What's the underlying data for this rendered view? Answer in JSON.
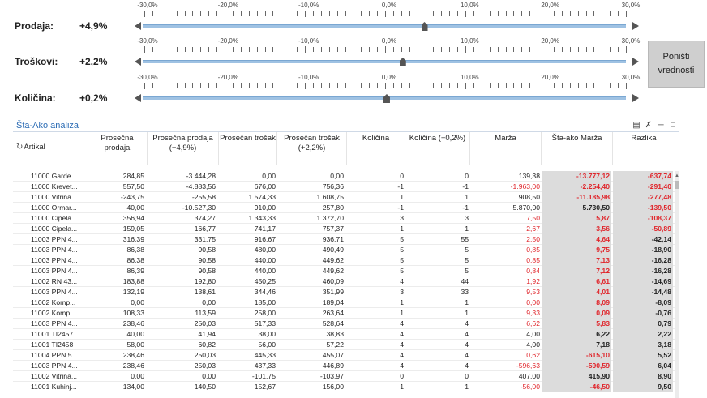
{
  "sliders": [
    {
      "label": "Prodaja:",
      "value": "+4,9%",
      "level_percent": 4.9
    },
    {
      "label": "Troškovi:",
      "value": "+2,2%",
      "level_percent": 2.2
    },
    {
      "label": "Količina:",
      "value": "+0,2%",
      "level_percent": 0.2
    }
  ],
  "tick_labels": [
    "-30,0%",
    "-20,0%",
    "-10,0%",
    "0,0%",
    "10,0%",
    "20,0%",
    "30,0%"
  ],
  "reset_button": {
    "label": "Poništi vrednosti"
  },
  "panel": {
    "title": "Šta-Ako analiza"
  },
  "columns": {
    "artikal": "Artikal",
    "c1": "Prosečna prodaja",
    "c2": "Prosečna prodaja (+4,9%)",
    "c3": "Prosečan trošak",
    "c4": "Prosečan trošak (+2,2%)",
    "c5": "Količina",
    "c6": "Količina (+0,2%)",
    "c7": "Marža",
    "c8": "Šta-ako Marža",
    "c9": "Razlika"
  },
  "rows": [
    [
      "11000 Garde...",
      "284,85",
      "-3.444,28",
      "0,00",
      "0,00",
      "0",
      "0",
      "139,38",
      "-13.777,12",
      "-637,74"
    ],
    [
      "11000 Krevet...",
      "557,50",
      "-4.883,56",
      "676,00",
      "756,36",
      "-1",
      "-1",
      "-1.963,00",
      "-2.254,40",
      "-291,40"
    ],
    [
      "11000 Vitrina...",
      "-243,75",
      "-255,58",
      "1.574,33",
      "1.608,75",
      "1",
      "1",
      "908,50",
      "-11.185,98",
      "-277,48"
    ],
    [
      "11000 Ormar...",
      "40,00",
      "-10.527,30",
      "910,00",
      "257,80",
      "-1",
      "-1",
      "5.870,00",
      "5.730,50",
      "-139,50"
    ],
    [
      "11000 Cipela...",
      "356,94",
      "374,27",
      "1.343,33",
      "1.372,70",
      "3",
      "3",
      "7,50",
      "5,87",
      "-108,37"
    ],
    [
      "11000 Cipela...",
      "159,05",
      "166,77",
      "741,17",
      "757,37",
      "1",
      "1",
      "2,67",
      "3,56",
      "-50,89"
    ],
    [
      "11003 PPN 4...",
      "316,39",
      "331,75",
      "916,67",
      "936,71",
      "5",
      "55",
      "2,50",
      "4,64",
      "-42,14"
    ],
    [
      "11003 PPN 4...",
      "86,38",
      "90,58",
      "480,00",
      "490,49",
      "5",
      "5",
      "0,85",
      "9,75",
      "-18,90"
    ],
    [
      "11003 PPN 4...",
      "86,38",
      "90,58",
      "440,00",
      "449,62",
      "5",
      "5",
      "0,85",
      "7,13",
      "-16,28"
    ],
    [
      "11003 PPN 4...",
      "86,39",
      "90,58",
      "440,00",
      "449,62",
      "5",
      "5",
      "0,84",
      "7,12",
      "-16,28"
    ],
    [
      "11002 RN 43...",
      "183,88",
      "192,80",
      "450,25",
      "460,09",
      "4",
      "44",
      "1,92",
      "6,61",
      "-14,69"
    ],
    [
      "11003 PPN 4...",
      "132,19",
      "138,61",
      "344,46",
      "351,99",
      "3",
      "33",
      "9,53",
      "4,01",
      "-14,48"
    ],
    [
      "11002 Komp...",
      "0,00",
      "0,00",
      "185,00",
      "189,04",
      "1",
      "1",
      "0,00",
      "8,09",
      "-8,09"
    ],
    [
      "11002 Komp...",
      "108,33",
      "113,59",
      "258,00",
      "263,64",
      "1",
      "1",
      "9,33",
      "0,09",
      "-0,76"
    ],
    [
      "11003 PPN 4...",
      "238,46",
      "250,03",
      "517,33",
      "528,64",
      "4",
      "4",
      "6,62",
      "5,83",
      "0,79"
    ],
    [
      "11001 TI2457",
      "40,00",
      "41,94",
      "38,00",
      "38,83",
      "4",
      "4",
      "4,00",
      "6,22",
      "2,22"
    ],
    [
      "11001 TI2458",
      "58,00",
      "60,82",
      "56,00",
      "57,22",
      "4",
      "4",
      "4,00",
      "7,18",
      "3,18"
    ],
    [
      "11004 PPN 5...",
      "238,46",
      "250,03",
      "445,33",
      "455,07",
      "4",
      "4",
      "0,62",
      "-615,10",
      "5,52"
    ],
    [
      "11003 PPN 4...",
      "238,46",
      "250,03",
      "437,33",
      "446,89",
      "4",
      "4",
      "-596,63",
      "-590,59",
      "6,04"
    ],
    [
      "11002 Vitrina...",
      "0,00",
      "0,00",
      "-101,75",
      "-103,97",
      "0",
      "0",
      "407,00",
      "415,90",
      "8,90"
    ],
    [
      "11001 Kuhinj...",
      "134,00",
      "140,50",
      "152,67",
      "156,00",
      "1",
      "1",
      "-56,00",
      "-46,50",
      "9,50"
    ]
  ]
}
